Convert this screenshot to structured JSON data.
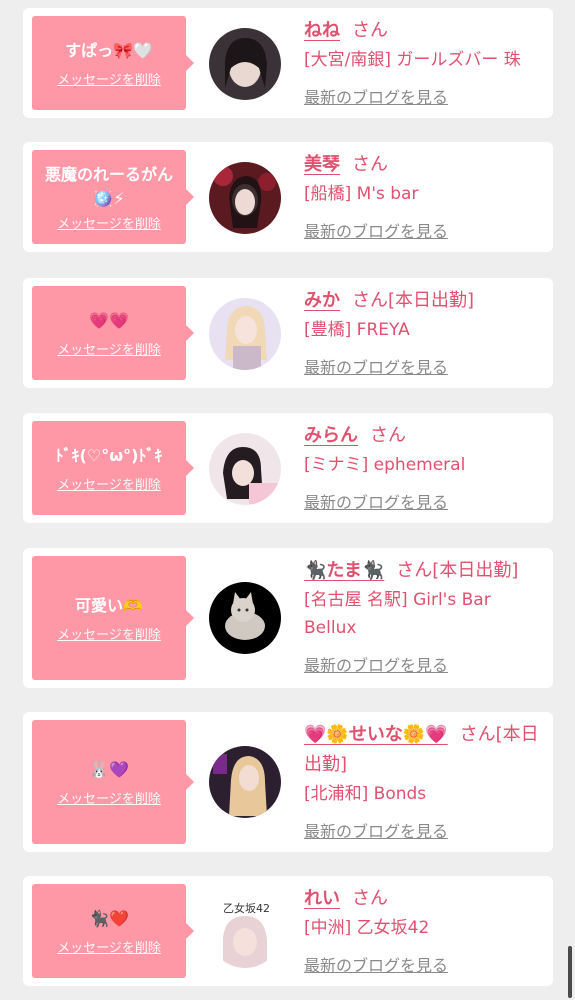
{
  "delete_label": "メッセージを削除",
  "blog_label": "最新のブログを見る",
  "honorific": "さん",
  "colors": {
    "accent": "#e0516f",
    "bubble": "#ff98a6",
    "link_gray": "#8a8a8a"
  },
  "entries": [
    {
      "message": "すぱっ🎀🤍",
      "name": "ねね",
      "status": "",
      "shop": "[大宮/南銀] ガールズバー 珠",
      "avatar_icon": "avatar-photo"
    },
    {
      "message": "悪魔のれーるがん\n🪩⚡",
      "name": "美琴",
      "status": "",
      "shop": "[船橋] M's bar",
      "avatar_icon": "avatar-photo"
    },
    {
      "message": "💗💗",
      "name": "みか",
      "status": "[本日出勤]",
      "shop": "[豊橋] FREYA",
      "avatar_icon": "avatar-photo"
    },
    {
      "message": "ﾄﾞｷ(♡°ω°)ﾄﾞｷ",
      "name": "みらん",
      "status": "",
      "shop": "[ミナミ] ephemeral",
      "avatar_icon": "avatar-photo"
    },
    {
      "message": "可愛い🫶",
      "name": "🐈‍⬛たま🐈‍⬛",
      "status": "[本日出勤]",
      "shop": "[名古屋 名駅] Girl's Bar Bellux",
      "avatar_icon": "cat-avatar"
    },
    {
      "message": "🐰💜",
      "name": "💗🌼せいな🌼💗",
      "status": "[本日出勤]",
      "shop": "[北浦和] Bonds",
      "avatar_icon": "avatar-photo"
    },
    {
      "message": "🐈‍⬛❤️",
      "name": "れい",
      "status": "",
      "shop": "[中洲] 乙女坂42",
      "avatar_icon": "avatar-photo",
      "avatar_text": "乙女坂42"
    }
  ]
}
